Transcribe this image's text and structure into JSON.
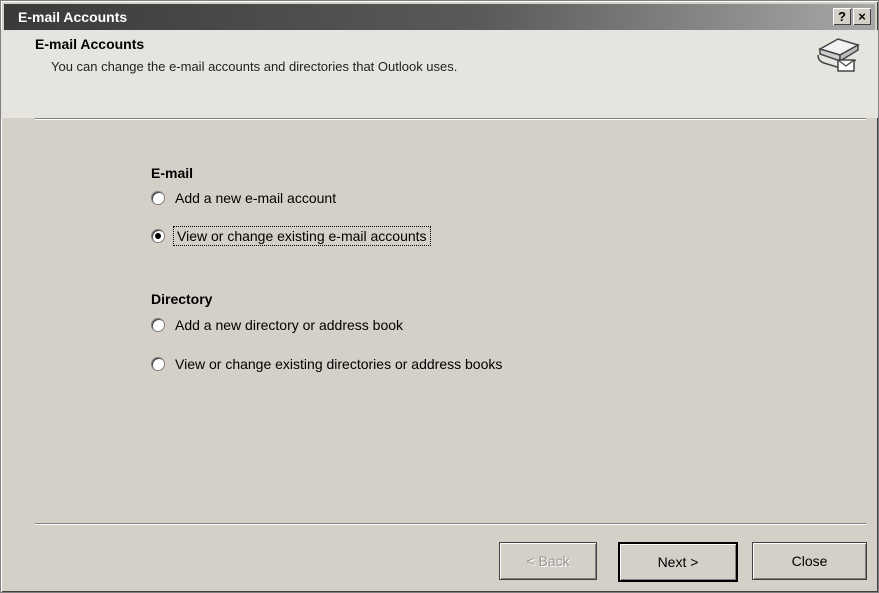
{
  "window": {
    "title": "E-mail Accounts",
    "help_glyph": "?",
    "close_glyph": "×"
  },
  "header": {
    "title": "E-mail Accounts",
    "description": "You can change the e-mail accounts and directories that Outlook uses."
  },
  "email_group": {
    "label": "E-mail",
    "options": [
      {
        "label": "Add a new e-mail account",
        "checked": false
      },
      {
        "label": "View or change existing e-mail accounts",
        "checked": true
      }
    ]
  },
  "directory_group": {
    "label": "Directory",
    "options": [
      {
        "label": "Add a new directory or address book",
        "checked": false
      },
      {
        "label": "View or change existing directories or address books",
        "checked": false
      }
    ]
  },
  "buttons": {
    "back": "< Back",
    "next": "Next >",
    "close": "Close"
  }
}
